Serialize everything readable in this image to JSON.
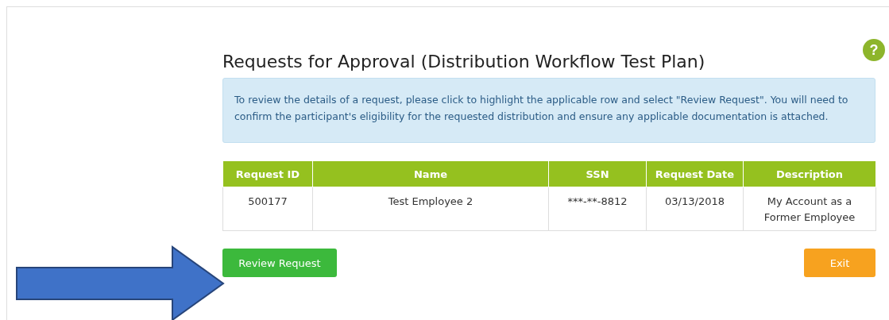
{
  "help_button": {
    "label": "?"
  },
  "title": "Requests for Approval (Distribution Workflow Test Plan)",
  "info_message": "To review the details of a request, please click to highlight the applicable row and select \"Review Request\". You will need to confirm the participant's eligibility for the requested distribution and ensure any applicable documentation is attached.",
  "table": {
    "columns": [
      "Request ID",
      "Name",
      "SSN",
      "Request Date",
      "Description"
    ],
    "rows": [
      {
        "selected": false,
        "cells": [
          "500177",
          "Test Employee 2",
          "***-**-8812",
          "03/13/2018",
          "My Account as a Former Employee"
        ]
      }
    ]
  },
  "buttons": [
    {
      "kind": "primary",
      "label": "Review Request"
    },
    {
      "kind": "exit",
      "label": "Exit"
    }
  ],
  "annotation": {
    "kind": "arrow"
  }
}
